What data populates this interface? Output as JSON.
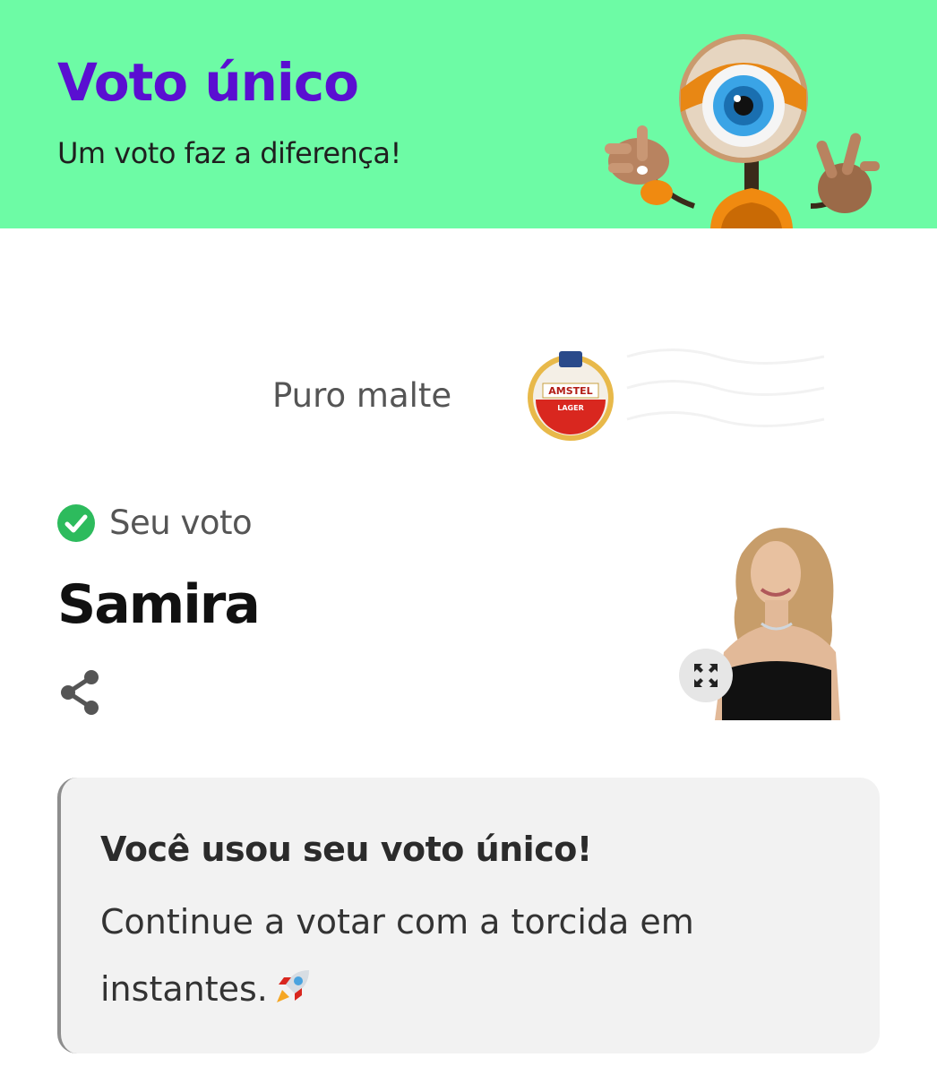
{
  "header": {
    "title": "Voto único",
    "subtitle": "Um voto faz a diferença!",
    "background_color": "#6dfba5",
    "title_color": "#5a0fd1",
    "mascot_icon": "big-brother-eye-mascot"
  },
  "sponsor": {
    "text": "Puro malte",
    "logo_icon": "amstel-lager-logo",
    "logo_text": "AMSTEL",
    "logo_subtext": "LAGER"
  },
  "vote": {
    "status_label": "Seu voto",
    "status_icon": "check-circle-icon",
    "status_color": "#2dbb5d",
    "candidate_name": "Samira",
    "share_icon": "share-icon",
    "expand_icon": "expand-icon",
    "photo": "candidate-photo"
  },
  "info_card": {
    "title": "Você usou seu voto único!",
    "text": "Continue a votar com a torcida em instantes.",
    "emoji_icon": "rocket-icon"
  }
}
